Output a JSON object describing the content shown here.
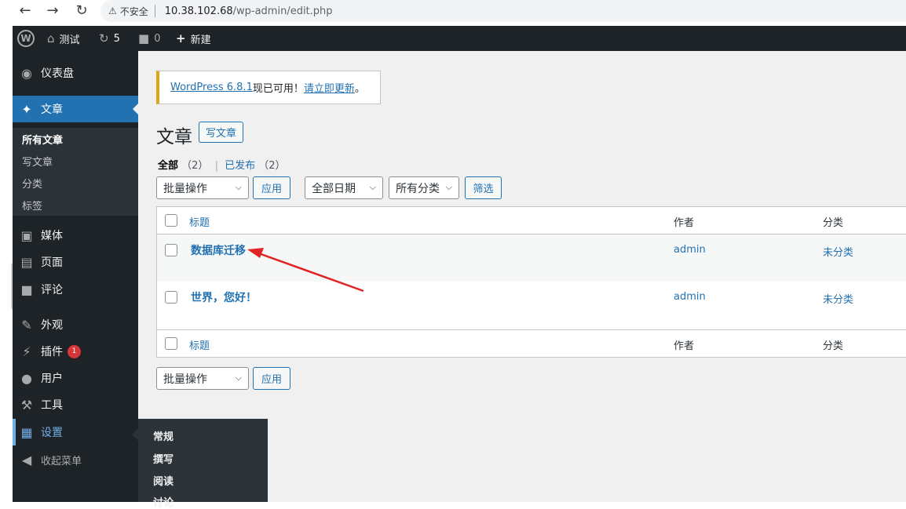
{
  "browser": {
    "insecure_label": "不安全",
    "url_host": "10.38.102.68",
    "url_path": "/wp-admin/edit.php"
  },
  "adminbar": {
    "wp_logo": "W",
    "site_name": "测试",
    "updates_count": "5",
    "comments_count": "0",
    "new_label": "新建"
  },
  "sidebar": {
    "dashboard": "仪表盘",
    "posts": "文章",
    "posts_submenu": [
      "所有文章",
      "写文章",
      "分类",
      "标签"
    ],
    "media": "媒体",
    "pages": "页面",
    "comments": "评论",
    "appearance": "外观",
    "plugins": "插件",
    "plugins_badge": "1",
    "users": "用户",
    "tools": "工具",
    "settings": "设置",
    "collapse": "收起菜单"
  },
  "flyout": {
    "items": [
      "常规",
      "撰写",
      "阅读",
      "讨论"
    ]
  },
  "notice": {
    "version_link": "WordPress 6.8.1",
    "middle_text": "现已可用！",
    "update_link": "请立即更新",
    "end_text": "。"
  },
  "page": {
    "title": "文章",
    "add_new": "写文章"
  },
  "filters": {
    "all_label": "全部",
    "all_count": "（2）",
    "sep": "|",
    "published_label": "已发布",
    "published_count": "（2）",
    "bulk_action": "批量操作",
    "apply": "应用",
    "all_dates": "全部日期",
    "all_categories": "所有分类",
    "filter": "筛选"
  },
  "table": {
    "columns": {
      "title": "标题",
      "author": "作者",
      "category": "分类"
    },
    "rows": [
      {
        "title": "数据库迁移",
        "author": "admin",
        "category": "未分类"
      },
      {
        "title": "世界，您好！",
        "author": "admin",
        "category": "未分类"
      }
    ]
  },
  "bottom": {
    "bulk_action": "批量操作",
    "apply": "应用"
  },
  "colors": {
    "accent": "#2271b1",
    "annotation_arrow": "#e02424",
    "sidebar_bg": "#1d2327",
    "notice_warning": "#dba617"
  }
}
